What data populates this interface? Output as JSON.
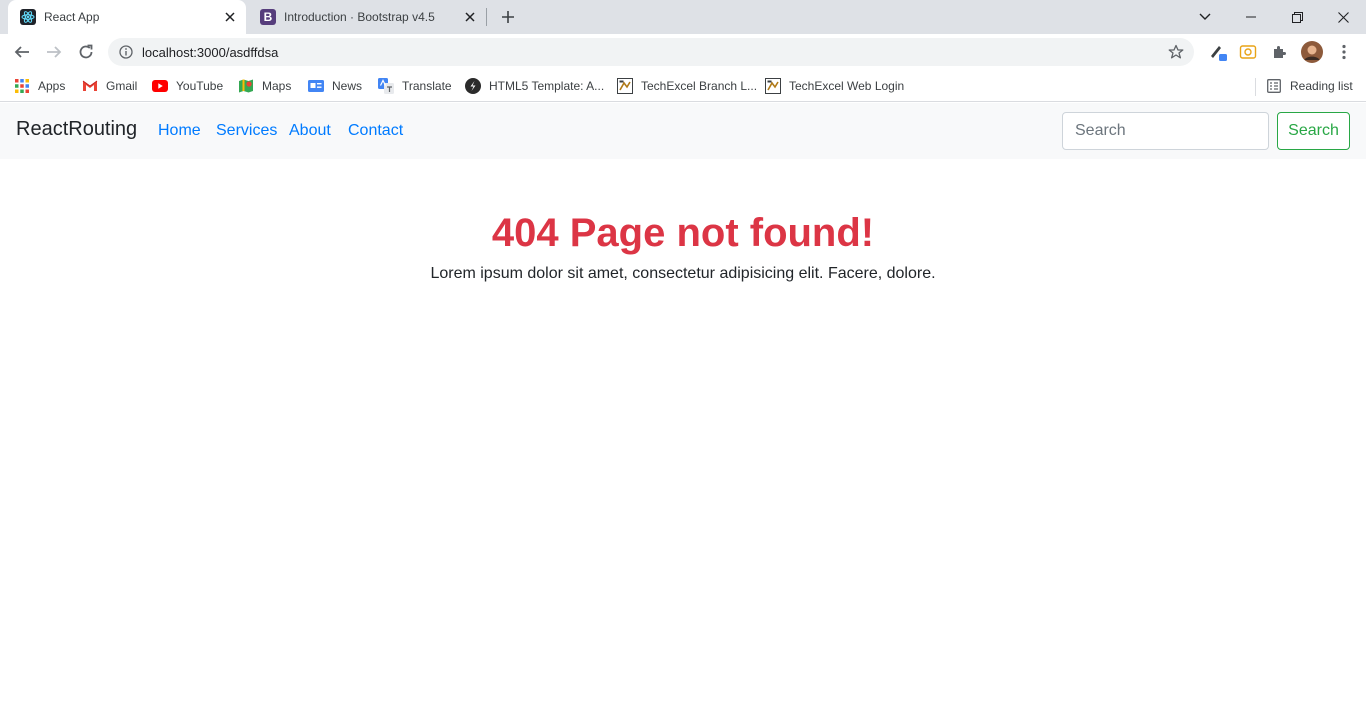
{
  "browser": {
    "tabs": [
      {
        "title": "React App",
        "active": true,
        "icon": "react-icon"
      },
      {
        "title": "Introduction · Bootstrap v4.5",
        "active": false,
        "icon": "bootstrap-icon"
      }
    ],
    "address": "localhost:3000/asdffdsa",
    "bookmarks": [
      {
        "label": "Apps",
        "icon": "apps-grid-icon"
      },
      {
        "label": "Gmail",
        "icon": "gmail-icon"
      },
      {
        "label": "YouTube",
        "icon": "youtube-icon"
      },
      {
        "label": "Maps",
        "icon": "maps-icon"
      },
      {
        "label": "News",
        "icon": "news-icon"
      },
      {
        "label": "Translate",
        "icon": "translate-icon"
      },
      {
        "label": "HTML5 Template: A...",
        "icon": "html5-template-icon"
      },
      {
        "label": "TechExcel Branch L...",
        "icon": "techexcel-icon"
      },
      {
        "label": "TechExcel Web Login",
        "icon": "techexcel-icon"
      }
    ],
    "reading_list": "Reading list",
    "colors": {
      "tabstrip": "#dee1e6",
      "omnibox": "#f1f3f4"
    }
  },
  "page": {
    "navbar": {
      "brand": "ReactRouting",
      "links": [
        "Home",
        "Services",
        "About",
        "Contact"
      ],
      "search_placeholder": "Search",
      "search_button": "Search"
    },
    "heading": "404 Page not found!",
    "text": "Lorem ipsum dolor sit amet, consectetur adipisicing elit. Facere, dolore.",
    "colors": {
      "link": "#007bff",
      "danger": "#dc3545",
      "success": "#28a745",
      "navbar_bg": "#f8f9fa"
    }
  }
}
